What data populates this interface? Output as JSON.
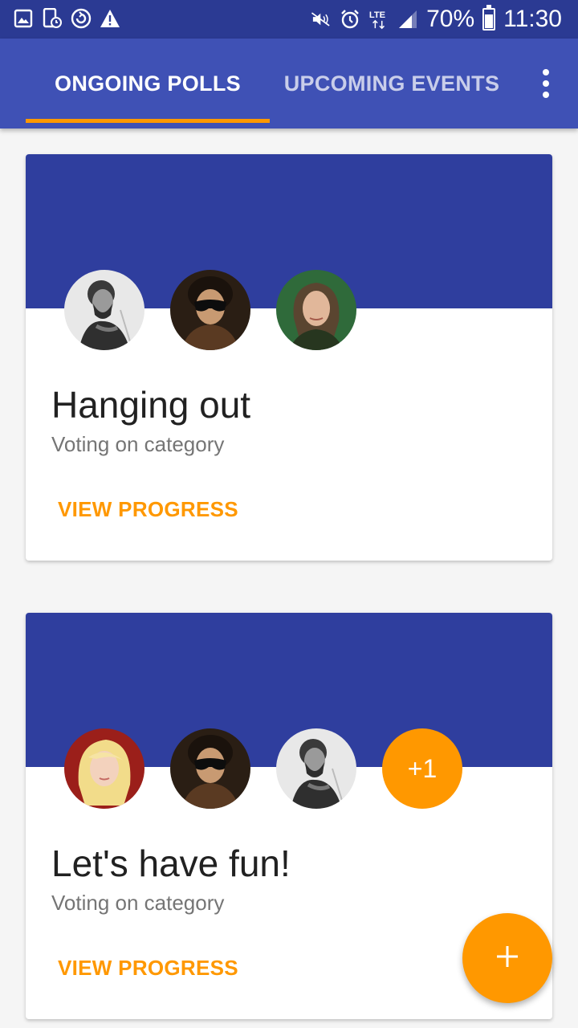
{
  "status_bar": {
    "battery_percent": "70%",
    "time": "11:30",
    "network": "LTE",
    "left_icons": [
      "gallery-icon",
      "device-clock-icon",
      "sync-icon",
      "warning-icon"
    ],
    "right_icons": [
      "mute-icon",
      "alarm-icon",
      "lte-icon",
      "signal-icon",
      "battery-icon"
    ]
  },
  "app_bar": {
    "tabs": [
      {
        "label": "ONGOING POLLS",
        "selected": true
      },
      {
        "label": "UPCOMING EVENTS",
        "selected": false
      }
    ],
    "overflow_icon": "more-vert-icon"
  },
  "polls": [
    {
      "title": "Hanging out",
      "subtitle": "Voting on category",
      "action": "VIEW PROGRESS",
      "participants": [
        "bearded-man-violin",
        "man-sunglasses",
        "woman-brown-hair"
      ]
    },
    {
      "title": "Let's have fun!",
      "subtitle": "Voting on category",
      "action": "VIEW PROGRESS",
      "participants": [
        "blonde-woman",
        "man-sunglasses",
        "bearded-man-violin"
      ],
      "more_count": "+1"
    }
  ],
  "fab": {
    "icon": "add-icon"
  },
  "colors": {
    "status_bar": "#2b3a93",
    "primary": "#3f51b5",
    "card_header": "#2f3e9e",
    "accent": "#ff9800",
    "title_text": "#212121",
    "subtitle_text": "#757575"
  }
}
